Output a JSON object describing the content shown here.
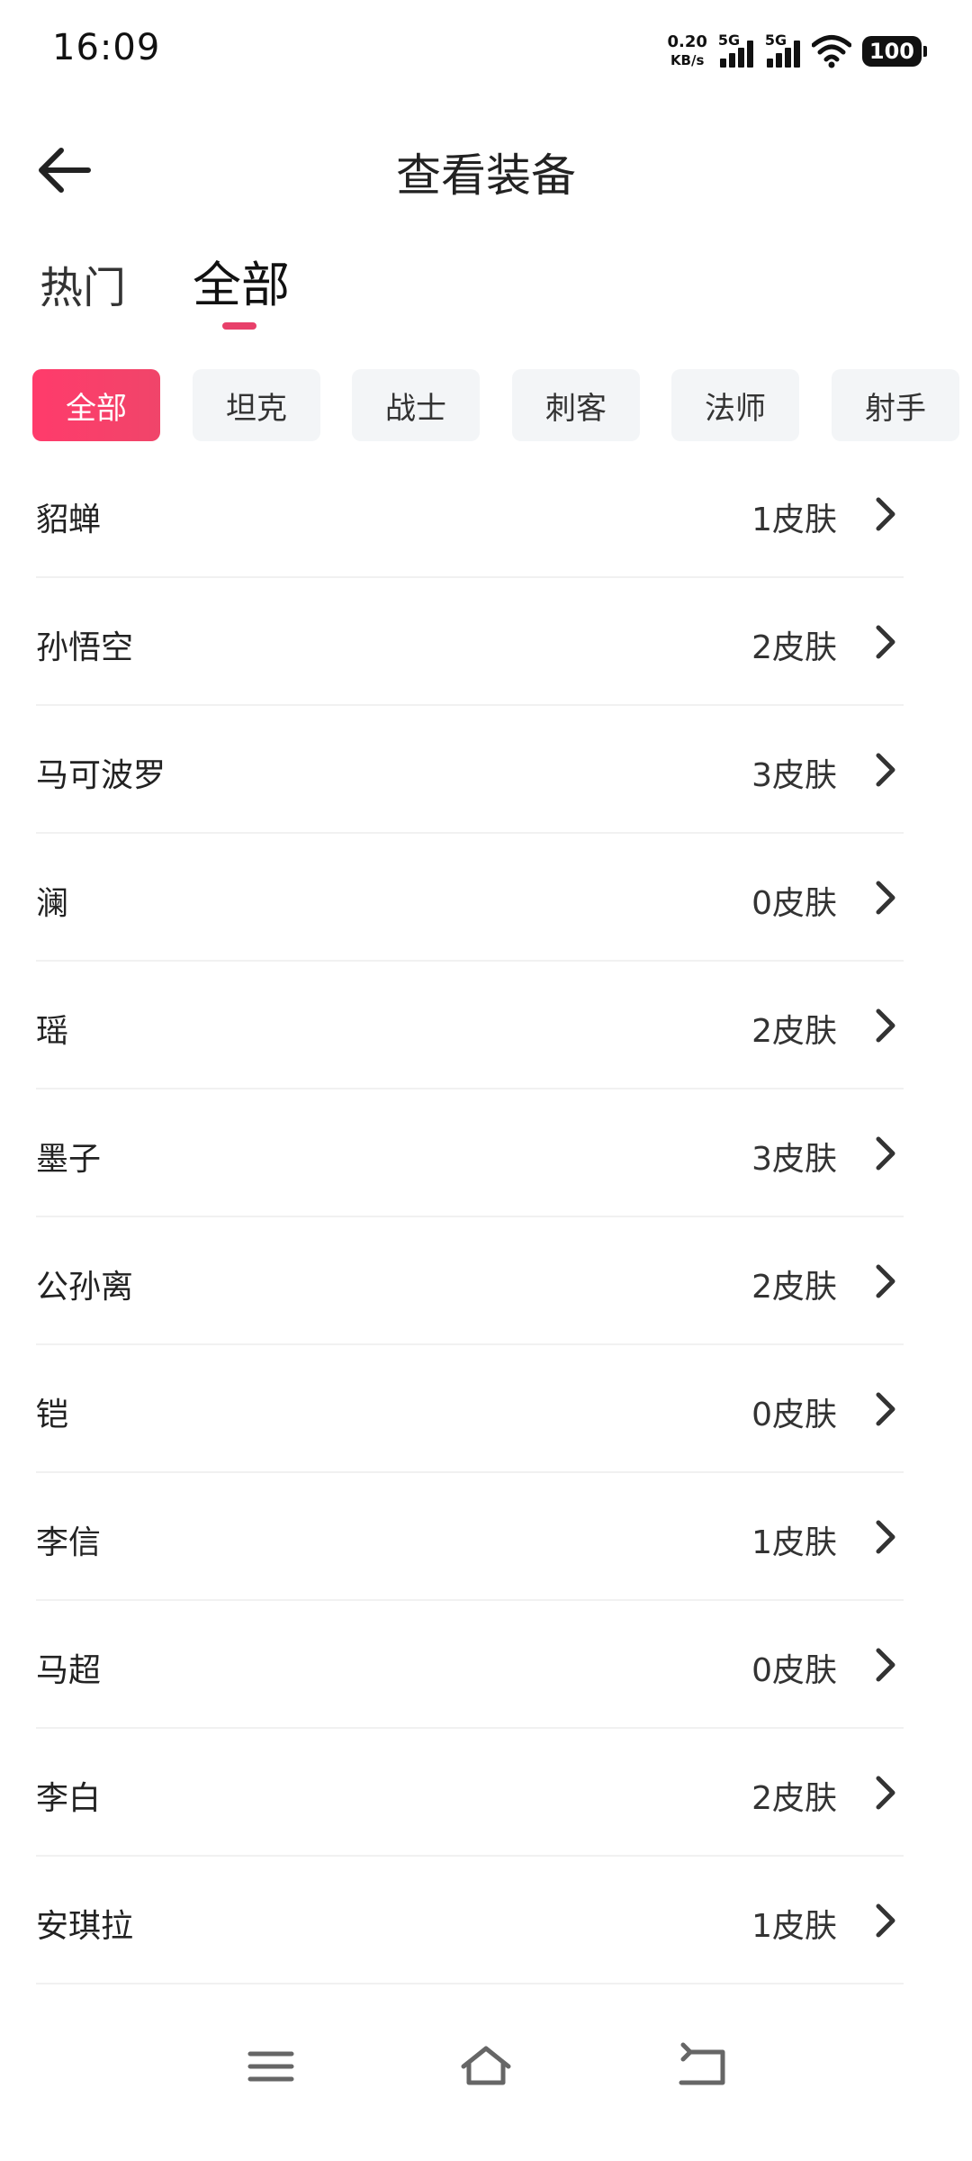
{
  "status": {
    "time": "16:09",
    "net_speed_value": "0.20",
    "net_speed_unit": "KB/s",
    "sim1_label": "5G",
    "sim2_label": "5G",
    "battery": "100"
  },
  "header": {
    "title": "查看装备",
    "back_icon": "arrow-left-icon"
  },
  "tabs": [
    {
      "label": "热门",
      "active": false
    },
    {
      "label": "全部",
      "active": true
    }
  ],
  "accent_color": "#ff3b6b",
  "chips": [
    {
      "label": "全部",
      "active": true
    },
    {
      "label": "坦克",
      "active": false
    },
    {
      "label": "战士",
      "active": false
    },
    {
      "label": "刺客",
      "active": false
    },
    {
      "label": "法师",
      "active": false
    },
    {
      "label": "射手",
      "active": false
    }
  ],
  "heroes": [
    {
      "name": "貂蝉",
      "skins": "1皮肤"
    },
    {
      "name": "孙悟空",
      "skins": "2皮肤"
    },
    {
      "name": "马可波罗",
      "skins": "3皮肤"
    },
    {
      "name": "澜",
      "skins": "0皮肤"
    },
    {
      "name": "瑶",
      "skins": "2皮肤"
    },
    {
      "name": "墨子",
      "skins": "3皮肤"
    },
    {
      "name": "公孙离",
      "skins": "2皮肤"
    },
    {
      "name": "铠",
      "skins": "0皮肤"
    },
    {
      "name": "李信",
      "skins": "1皮肤"
    },
    {
      "name": "马超",
      "skins": "0皮肤"
    },
    {
      "name": "李白",
      "skins": "2皮肤"
    },
    {
      "name": "安琪拉",
      "skins": "1皮肤"
    }
  ],
  "nav": {
    "menu_icon": "menu-icon",
    "home_icon": "home-icon",
    "back_icon": "back-icon"
  }
}
